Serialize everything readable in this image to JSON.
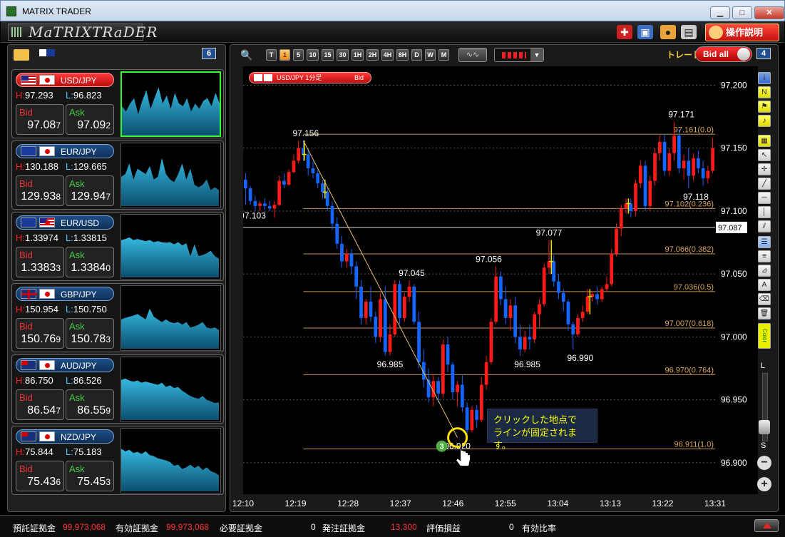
{
  "window": {
    "title": "MATRIX TRADER"
  },
  "toolbar": {
    "logo_text": "MaTRIXTRaDER",
    "help_label": "操作説明",
    "icons": [
      "toolbox-icon",
      "save-icon",
      "palette-icon",
      "print-icon"
    ]
  },
  "left_panel": {
    "count": "6"
  },
  "pairs": [
    {
      "name": "USD/JPY",
      "flag_a": "us",
      "high": "97.293",
      "low": "96.823",
      "bid_lab": "Bid",
      "ask_lab": "Ask",
      "bid_pre": "97.08",
      "bid_last": "7",
      "ask_pre": "97.09",
      "ask_last": "2",
      "selected": true,
      "spark": [
        0.55,
        0.45,
        0.6,
        0.7,
        0.4,
        0.65,
        0.85,
        0.5,
        0.7,
        0.9,
        0.6,
        0.75,
        0.5,
        0.8,
        0.6,
        0.55,
        0.7,
        0.45,
        0.6,
        0.5,
        0.65,
        0.7,
        0.55,
        0.8,
        0.6
      ]
    },
    {
      "name": "EUR/JPY",
      "flag_a": "eu",
      "high": "130.188",
      "low": "129.665",
      "bid_lab": "Bid",
      "ask_lab": "Ask",
      "bid_pre": "129.93",
      "bid_last": "8",
      "ask_pre": "129.94",
      "ask_last": "7",
      "selected": false,
      "spark": [
        0.55,
        0.6,
        0.8,
        0.5,
        0.7,
        0.65,
        0.6,
        0.75,
        0.5,
        0.55,
        0.9,
        0.6,
        0.5,
        0.45,
        0.6,
        0.8,
        0.5,
        0.7,
        0.4,
        0.35,
        0.4,
        0.5,
        0.3,
        0.35,
        0.3
      ]
    },
    {
      "name": "EUR/USD",
      "flag_a": "eu",
      "flag_b": "us",
      "high": "1.33974",
      "low": "1.33815",
      "bid_lab": "Bid",
      "ask_lab": "Ask",
      "bid_pre": "1.3383",
      "bid_last": "3",
      "ask_pre": "1.3384",
      "ask_last": "0",
      "selected": false,
      "spark": [
        0.7,
        0.72,
        0.75,
        0.7,
        0.72,
        0.7,
        0.68,
        0.7,
        0.66,
        0.68,
        0.66,
        0.65,
        0.66,
        0.62,
        0.66,
        0.6,
        0.64,
        0.4,
        0.62,
        0.4,
        0.42,
        0.45,
        0.5,
        0.4,
        0.35
      ]
    },
    {
      "name": "GBP/JPY",
      "flag_a": "gb",
      "high": "150.954",
      "low": "150.750",
      "bid_lab": "Bid",
      "ask_lab": "Ask",
      "bid_pre": "150.76",
      "bid_last": "9",
      "ask_pre": "150.78",
      "ask_last": "3",
      "selected": false,
      "spark": [
        0.55,
        0.58,
        0.6,
        0.62,
        0.65,
        0.6,
        0.55,
        0.75,
        0.6,
        0.55,
        0.5,
        0.55,
        0.5,
        0.48,
        0.5,
        0.45,
        0.5,
        0.4,
        0.42,
        0.45,
        0.5,
        0.4,
        0.38,
        0.4,
        0.35
      ]
    },
    {
      "name": "AUD/JPY",
      "flag_a": "au",
      "high": "86.750",
      "low": "86.526",
      "bid_lab": "Bid",
      "ask_lab": "Ask",
      "bid_pre": "86.54",
      "bid_last": "7",
      "ask_pre": "86.55",
      "ask_last": "9",
      "selected": false,
      "spark": [
        0.75,
        0.78,
        0.74,
        0.72,
        0.74,
        0.7,
        0.72,
        0.7,
        0.68,
        0.66,
        0.7,
        0.62,
        0.65,
        0.6,
        0.62,
        0.55,
        0.5,
        0.45,
        0.42,
        0.4,
        0.45,
        0.38,
        0.35,
        0.32,
        0.33
      ]
    },
    {
      "name": "NZD/JPY",
      "flag_a": "nz",
      "high": "75.844",
      "low": "75.183",
      "bid_lab": "Bid",
      "ask_lab": "Ask",
      "bid_pre": "75.43",
      "bid_last": "6",
      "ask_pre": "75.45",
      "ask_last": "3",
      "selected": false,
      "spark": [
        0.8,
        0.75,
        0.78,
        0.72,
        0.74,
        0.7,
        0.75,
        0.68,
        0.66,
        0.62,
        0.6,
        0.58,
        0.55,
        0.48,
        0.5,
        0.42,
        0.45,
        0.5,
        0.44,
        0.48,
        0.4,
        0.45,
        0.38,
        0.35,
        0.3
      ]
    }
  ],
  "chart_header": {
    "timeframes": [
      "T",
      "1",
      "5",
      "10",
      "15",
      "30",
      "1H",
      "2H",
      "4H",
      "8H",
      "D",
      "W",
      "M"
    ],
    "active_timeframe": "1",
    "trade_label": "トレード",
    "bid_all_label": "Bid all",
    "count": "4",
    "chart_tag": "USD/JPY 1分足",
    "chart_tag_side": "Bid"
  },
  "chart_data": {
    "type": "candlestick",
    "y_ticks": [
      "97.200",
      "97.150",
      "97.100",
      "97.050",
      "97.000",
      "96.950",
      "96.900"
    ],
    "ylim": [
      96.875,
      97.215
    ],
    "x_ticks": [
      "12:10",
      "12:19",
      "12:28",
      "12:37",
      "12:46",
      "12:55",
      "13:04",
      "13:13",
      "13:22",
      "13:31"
    ],
    "current_price": "97.087",
    "fib_levels": [
      {
        "label": "97.161(0.0)",
        "value": 97.161
      },
      {
        "label": "97.102(0.236)",
        "value": 97.102
      },
      {
        "label": "97.066(0.382)",
        "value": 97.066
      },
      {
        "label": "97.036(0.5)",
        "value": 97.036
      },
      {
        "label": "97.007(0.618)",
        "value": 97.007
      },
      {
        "label": "96.970(0.764)",
        "value": 96.97
      },
      {
        "label": "96.911(1.0)",
        "value": 96.911
      }
    ],
    "annotations": [
      {
        "text": "97.156",
        "x": 12.5,
        "value": 97.156
      },
      {
        "text": "97.103",
        "x": 1.5,
        "value": 97.103
      },
      {
        "text": "97.045",
        "x": 34.5,
        "value": 97.045
      },
      {
        "text": "96.985",
        "x": 30,
        "value": 96.985
      },
      {
        "text": "97.056",
        "x": 50.5,
        "value": 97.056
      },
      {
        "text": "96.985",
        "x": 58.5,
        "value": 96.985
      },
      {
        "text": "97.077",
        "x": 63,
        "value": 97.077
      },
      {
        "text": "96.990",
        "x": 69.5,
        "value": 96.99
      },
      {
        "text": "97.171",
        "x": 90.5,
        "value": 97.171
      },
      {
        "text": "97.118",
        "x": 93.5,
        "value": 97.118
      },
      {
        "text": "96.920",
        "x": 44,
        "value": 96.92
      }
    ],
    "candles": [
      [
        97.125,
        97.13,
        97.105,
        97.118
      ],
      [
        97.118,
        97.12,
        97.105,
        97.108
      ],
      [
        97.108,
        97.112,
        97.1,
        97.104
      ],
      [
        97.104,
        97.108,
        97.1,
        97.106
      ],
      [
        97.106,
        97.11,
        97.101,
        97.104
      ],
      [
        97.104,
        97.108,
        97.1,
        97.102
      ],
      [
        97.102,
        97.108,
        97.095,
        97.105
      ],
      [
        97.105,
        97.128,
        97.104,
        97.124
      ],
      [
        97.124,
        97.13,
        97.118,
        97.121
      ],
      [
        97.121,
        97.133,
        97.12,
        97.131
      ],
      [
        97.131,
        97.145,
        97.13,
        97.14
      ],
      [
        97.14,
        97.156,
        97.138,
        97.15
      ],
      [
        97.15,
        97.156,
        97.14,
        97.145
      ],
      [
        97.145,
        97.15,
        97.128,
        97.134
      ],
      [
        97.134,
        97.14,
        97.126,
        97.13
      ],
      [
        97.13,
        97.133,
        97.118,
        97.122
      ],
      [
        97.122,
        97.125,
        97.11,
        97.115
      ],
      [
        97.115,
        97.118,
        97.1,
        97.104
      ],
      [
        97.104,
        97.108,
        97.085,
        97.09
      ],
      [
        97.09,
        97.095,
        97.07,
        97.074
      ],
      [
        97.074,
        97.08,
        97.055,
        97.06
      ],
      [
        97.06,
        97.07,
        97.055,
        97.066
      ],
      [
        97.066,
        97.07,
        97.05,
        97.056
      ],
      [
        97.056,
        97.06,
        97.03,
        97.04
      ],
      [
        97.04,
        97.045,
        97.01,
        97.015
      ],
      [
        97.015,
        97.03,
        97.01,
        97.028
      ],
      [
        97.028,
        97.04,
        97.012,
        97.016
      ],
      [
        97.016,
        97.02,
        96.995,
        97.0
      ],
      [
        97.0,
        97.035,
        96.996,
        97.03
      ],
      [
        97.03,
        97.04,
        96.985,
        96.988
      ],
      [
        96.988,
        97.01,
        96.985,
        97.002
      ],
      [
        97.002,
        97.045,
        97.0,
        97.042
      ],
      [
        97.042,
        97.045,
        97.01,
        97.015
      ],
      [
        97.015,
        97.035,
        97.012,
        97.032
      ],
      [
        97.032,
        97.045,
        97.028,
        97.04
      ],
      [
        97.04,
        97.042,
        97.01,
        97.012
      ],
      [
        97.012,
        97.02,
        96.975,
        96.98
      ],
      [
        96.98,
        96.99,
        96.96,
        96.966
      ],
      [
        96.966,
        96.975,
        96.948,
        96.952
      ],
      [
        96.952,
        96.97,
        96.945,
        96.965
      ],
      [
        96.965,
        96.968,
        96.948,
        96.955
      ],
      [
        96.955,
        96.998,
        96.952,
        96.994
      ],
      [
        96.994,
        97.0,
        96.972,
        96.978
      ],
      [
        96.978,
        96.98,
        96.95,
        96.956
      ],
      [
        96.956,
        96.965,
        96.945,
        96.962
      ],
      [
        96.962,
        96.97,
        96.94,
        96.944
      ],
      [
        96.944,
        96.948,
        96.92,
        96.926
      ],
      [
        96.926,
        96.945,
        96.924,
        96.942
      ],
      [
        96.942,
        96.946,
        96.928,
        96.934
      ],
      [
        96.934,
        96.968,
        96.932,
        96.962
      ],
      [
        96.962,
        96.985,
        96.958,
        96.98
      ],
      [
        96.98,
        97.015,
        96.978,
        97.012
      ],
      [
        97.012,
        97.056,
        97.01,
        97.048
      ],
      [
        97.048,
        97.052,
        97.025,
        97.03
      ],
      [
        97.03,
        97.04,
        97.01,
        97.015
      ],
      [
        97.015,
        97.03,
        97.005,
        97.025
      ],
      [
        97.025,
        97.032,
        96.995,
        97.0
      ],
      [
        97.0,
        97.01,
        96.985,
        96.99
      ],
      [
        96.99,
        97.005,
        96.988,
        97.0
      ],
      [
        97.0,
        97.01,
        96.99,
        96.998
      ],
      [
        96.998,
        97.02,
        96.995,
        97.018
      ],
      [
        97.018,
        97.03,
        97.008,
        97.026
      ],
      [
        97.026,
        97.058,
        97.024,
        97.055
      ],
      [
        97.055,
        97.077,
        97.05,
        97.06
      ],
      [
        97.06,
        97.065,
        97.04,
        97.044
      ],
      [
        97.044,
        97.05,
        97.03,
        97.035
      ],
      [
        97.035,
        97.038,
        97.02,
        97.028
      ],
      [
        97.028,
        97.03,
        97.005,
        97.01
      ],
      [
        97.01,
        97.012,
        96.99,
        97.002
      ],
      [
        97.002,
        97.018,
        97.0,
        97.015
      ],
      [
        97.015,
        97.025,
        97.012,
        97.02
      ],
      [
        97.02,
        97.038,
        97.018,
        97.032
      ],
      [
        97.032,
        97.036,
        97.028,
        97.034
      ],
      [
        97.034,
        97.04,
        97.026,
        97.03
      ],
      [
        97.03,
        97.04,
        97.028,
        97.038
      ],
      [
        97.038,
        97.048,
        97.036,
        97.042
      ],
      [
        97.042,
        97.07,
        97.04,
        97.066
      ],
      [
        97.066,
        97.09,
        97.064,
        97.086
      ],
      [
        97.086,
        97.105,
        97.08,
        97.102
      ],
      [
        97.102,
        97.11,
        97.098,
        97.106
      ],
      [
        97.106,
        97.11,
        97.095,
        97.1
      ],
      [
        97.1,
        97.125,
        97.096,
        97.122
      ],
      [
        97.122,
        97.14,
        97.118,
        97.136
      ],
      [
        97.136,
        97.14,
        97.1,
        97.104
      ],
      [
        97.104,
        97.128,
        97.1,
        97.124
      ],
      [
        97.124,
        97.15,
        97.12,
        97.146
      ],
      [
        97.146,
        97.16,
        97.14,
        97.155
      ],
      [
        97.155,
        97.161,
        97.128,
        97.132
      ],
      [
        97.132,
        97.15,
        97.128,
        97.146
      ],
      [
        97.146,
        97.171,
        97.14,
        97.16
      ],
      [
        97.16,
        97.165,
        97.13,
        97.134
      ],
      [
        97.134,
        97.145,
        97.125,
        97.14
      ],
      [
        97.14,
        97.15,
        97.118,
        97.128
      ],
      [
        97.128,
        97.146,
        97.124,
        97.142
      ],
      [
        97.142,
        97.148,
        97.13,
        97.134
      ],
      [
        97.134,
        97.14,
        97.12,
        97.126
      ],
      [
        97.126,
        97.136,
        97.122,
        97.132
      ],
      [
        97.132,
        97.158,
        97.13,
        97.15
      ]
    ],
    "doji_marks": [
      12.2,
      16.5,
      63.5,
      71.5,
      79.5
    ],
    "trend_line": {
      "from": [
        12,
        97.156
      ],
      "to": [
        44,
        96.92
      ]
    }
  },
  "callout": {
    "line1": "クリックした地点で",
    "line2": "ラインが固定されます。",
    "step": "3"
  },
  "right_tools": {
    "slider_l": "L",
    "slider_s": "S",
    "color_label": "Color"
  },
  "status": [
    {
      "label": "預託証拠金",
      "value": "99,973,068",
      "red": true
    },
    {
      "label": "有効証拠金",
      "value": "99,973,068",
      "red": true
    },
    {
      "label": "必要証拠金",
      "value": "0",
      "red": false
    },
    {
      "label": "発注証拠金",
      "value": "13,300",
      "red": true
    },
    {
      "label": "評価損益",
      "value": "0",
      "red": false
    },
    {
      "label": "有効比率",
      "value": "",
      "red": false
    }
  ],
  "colors": {
    "up": "#ff1a1a",
    "down": "#1565ff",
    "fib": "#c2924e",
    "grid": "#555555",
    "accent": "#ff3333"
  }
}
